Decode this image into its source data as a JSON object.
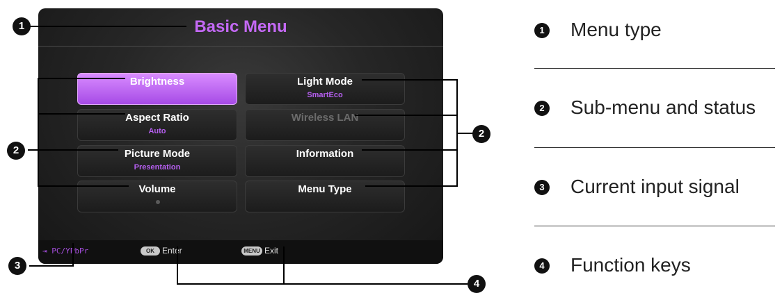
{
  "osd": {
    "title": "Basic Menu",
    "tiles": [
      {
        "label": "Brightness",
        "status": "",
        "selected": true,
        "disabled": false
      },
      {
        "label": "Light Mode",
        "status": "SmartEco",
        "selected": false,
        "disabled": false
      },
      {
        "label": "Aspect Ratio",
        "status": "Auto",
        "selected": false,
        "disabled": false
      },
      {
        "label": "Wireless LAN",
        "status": "",
        "selected": false,
        "disabled": true
      },
      {
        "label": "Picture Mode",
        "status": "Presentation",
        "selected": false,
        "disabled": false
      },
      {
        "label": "Information",
        "status": "",
        "selected": false,
        "disabled": false
      },
      {
        "label": "Volume",
        "status": "",
        "selected": false,
        "disabled": false
      },
      {
        "label": "Menu Type",
        "status": "",
        "selected": false,
        "disabled": false
      }
    ],
    "footer": {
      "input_signal": "PC/YPbPr",
      "enter_key": "OK",
      "enter_label": "Enter",
      "exit_key": "MENU",
      "exit_label": "Exit"
    }
  },
  "callouts": [
    "1",
    "2",
    "2",
    "3",
    "4"
  ],
  "legend": [
    {
      "num": "1",
      "text": "Menu type"
    },
    {
      "num": "2",
      "text": "Sub-menu and status"
    },
    {
      "num": "3",
      "text": "Current input signal"
    },
    {
      "num": "4",
      "text": "Function keys"
    }
  ],
  "colors": {
    "accent": "#c469f5",
    "selected_tile": "#b65ff0",
    "osd_background": "#262626"
  }
}
